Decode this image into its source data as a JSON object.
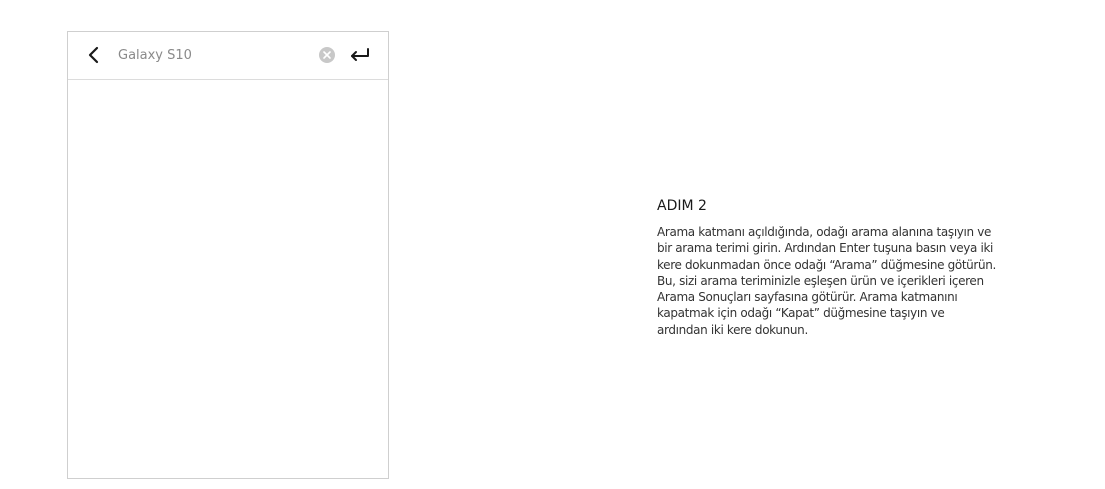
{
  "search": {
    "value": "Galaxy S10",
    "placeholder": "Galaxy S10"
  },
  "icons": {
    "back": "chevron-left-icon",
    "clear": "clear-circle-icon",
    "enter": "enter-return-icon"
  },
  "instructions": {
    "title": "ADIM 2",
    "text": "Arama katmanı açıldığında, odağı arama alanına taşıyın ve\nbir arama terimi girin. Ardından Enter tuşuna basın veya iki\nkere dokunmadan önce odağı “Arama” düğmesine götürün.\nBu, sizi arama teriminizle eşleşen ürün ve içerikleri içeren\nArama Sonuçları sayfasına götürür. Arama katmanını\nkapatmak için odağı “Kapat” düğmesine taşıyın ve\nardından iki kere dokunun."
  },
  "colors": {
    "border": "#cfcfcf",
    "icon": "#1a1a1a",
    "clear_icon": "#c8c8c8",
    "input_text": "#8a8a8a"
  }
}
